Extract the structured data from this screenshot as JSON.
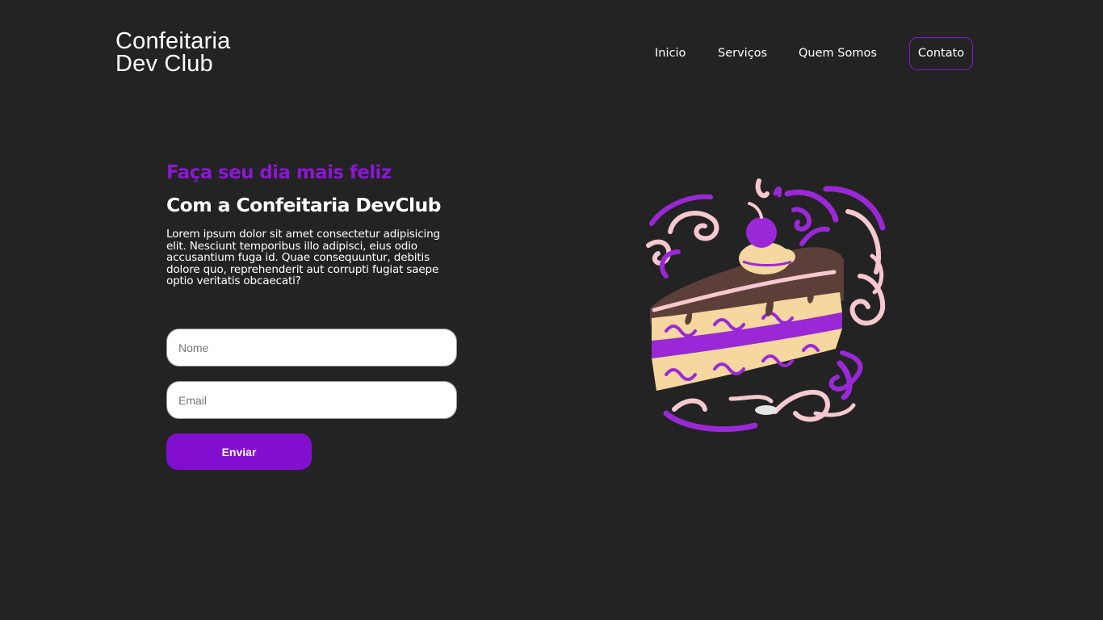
{
  "brand": {
    "line1": "Confeitaria",
    "line2": "Dev Club"
  },
  "nav": {
    "items": [
      {
        "label": "Inicio"
      },
      {
        "label": "Serviços"
      },
      {
        "label": "Quem Somos"
      },
      {
        "label": "Contato"
      }
    ],
    "active_border_color": "#7f1ad0"
  },
  "hero": {
    "kicker": "Faça seu dia mais feliz",
    "headline": "Com a Confeitaria DevClub",
    "description": "Lorem ipsum dolor sit amet consectetur adipisicing elit. Nesciunt temporibus illo adipisci, eius odio accusantium fuga id. Quae consequuntur, debitis dolore quo, reprehenderit aut corrupti fugiat saepe optio veritatis obcaecati?"
  },
  "form": {
    "name_placeholder": "Nome",
    "email_placeholder": "Email",
    "submit_label": "Enviar"
  },
  "illustration": {
    "icon": "cake-slice-illustration"
  },
  "colors": {
    "background": "#232323",
    "accent": "#820fd0",
    "text": "#ffffff"
  }
}
